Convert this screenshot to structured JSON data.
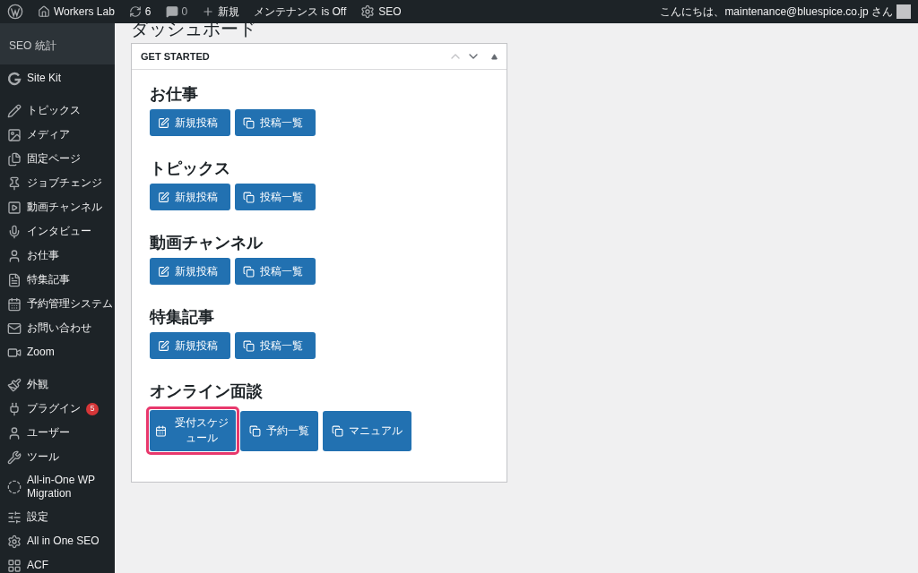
{
  "admin_bar": {
    "site": "Workers Lab",
    "updates": "6",
    "comments": "0",
    "new": "新規",
    "maintenance": "メンテナンス is Off",
    "seo": "SEO",
    "greeting": "こんにちは、maintenance@bluespice.co.jp さん"
  },
  "sidebar": {
    "submenu": [
      "SEO 統計"
    ],
    "groups": [
      {
        "items": [
          {
            "label": "Site Kit",
            "kind": "g"
          }
        ]
      },
      {
        "items": [
          {
            "label": "トピックス",
            "kind": "pencil"
          },
          {
            "label": "メディア",
            "kind": "media"
          },
          {
            "label": "固定ページ",
            "kind": "pages"
          },
          {
            "label": "ジョブチェンジ",
            "kind": "pin"
          },
          {
            "label": "動画チャンネル",
            "kind": "video"
          },
          {
            "label": "インタビュー",
            "kind": "mic"
          },
          {
            "label": "お仕事",
            "kind": "person"
          },
          {
            "label": "特集記事",
            "kind": "doc"
          },
          {
            "label": "予約管理システム",
            "kind": "calendar"
          },
          {
            "label": "お問い合わせ",
            "kind": "mail"
          },
          {
            "label": "Zoom",
            "kind": "camera"
          }
        ]
      },
      {
        "items": [
          {
            "label": "外観",
            "kind": "brush"
          },
          {
            "label": "プラグイン",
            "kind": "plug",
            "badge": "5"
          },
          {
            "label": "ユーザー",
            "kind": "user"
          },
          {
            "label": "ツール",
            "kind": "wrench"
          },
          {
            "label": "All-in-One WP Migration",
            "kind": "ring"
          },
          {
            "label": "設定",
            "kind": "sliders"
          },
          {
            "label": "All in One SEO",
            "kind": "gear"
          },
          {
            "label": "ACF",
            "kind": "grid"
          }
        ]
      }
    ]
  },
  "page_title": "ダッシュボード",
  "panel": {
    "title": "GET STARTED",
    "sections": [
      {
        "heading": "お仕事",
        "buttons": [
          {
            "label": "新規投稿",
            "kind": "new",
            "highlighted": false
          },
          {
            "label": "投稿一覧",
            "kind": "list",
            "highlighted": false
          }
        ]
      },
      {
        "heading": "トピックス",
        "buttons": [
          {
            "label": "新規投稿",
            "kind": "new",
            "highlighted": false
          },
          {
            "label": "投稿一覧",
            "kind": "list",
            "highlighted": false
          }
        ]
      },
      {
        "heading": "動画チャンネル",
        "buttons": [
          {
            "label": "新規投稿",
            "kind": "new",
            "highlighted": false
          },
          {
            "label": "投稿一覧",
            "kind": "list",
            "highlighted": false
          }
        ]
      },
      {
        "heading": "特集記事",
        "buttons": [
          {
            "label": "新規投稿",
            "kind": "new",
            "highlighted": false
          },
          {
            "label": "投稿一覧",
            "kind": "list",
            "highlighted": false
          }
        ]
      },
      {
        "heading": "オンライン面談",
        "buttons": [
          {
            "label": "受付スケジュール",
            "kind": "calendar",
            "highlighted": true
          },
          {
            "label": "予約一覧",
            "kind": "list",
            "highlighted": false
          },
          {
            "label": "マニュアル",
            "kind": "list",
            "highlighted": false
          }
        ]
      }
    ]
  }
}
